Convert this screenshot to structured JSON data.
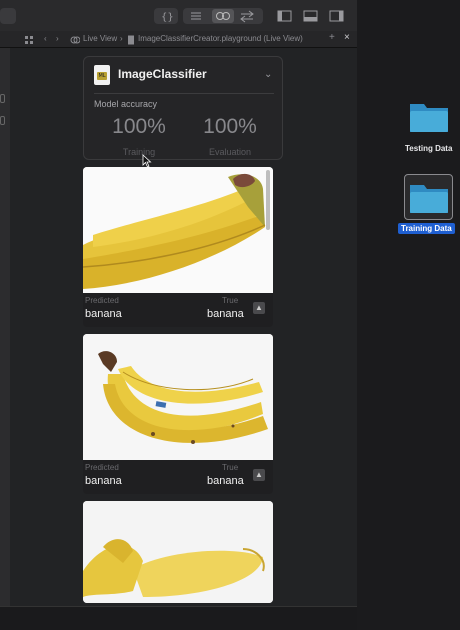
{
  "jumpbar": {
    "live_view": "Live View",
    "separator": "›",
    "file": "ImageClassifierCreator.playground (Live View)"
  },
  "panel": {
    "title": "ImageClassifier",
    "icon_text": "ML",
    "accuracy_label": "Model accuracy",
    "training_value": "100%",
    "training_label": "Training",
    "evaluation_value": "100%",
    "evaluation_label": "Evaluation"
  },
  "cards": [
    {
      "predicted_label": "Predicted",
      "predicted": "banana",
      "true_label": "True",
      "true": "banana"
    },
    {
      "predicted_label": "Predicted",
      "predicted": "banana",
      "true_label": "True",
      "true": "banana"
    }
  ],
  "desktop": {
    "folders": [
      {
        "name": "Testing Data",
        "selected": false
      },
      {
        "name": "Training Data",
        "selected": true
      }
    ]
  },
  "colors": {
    "folder_blue": "#3fa3d6",
    "selection_blue": "#1f5fd1",
    "banana_yellow": "#e8c53a"
  }
}
